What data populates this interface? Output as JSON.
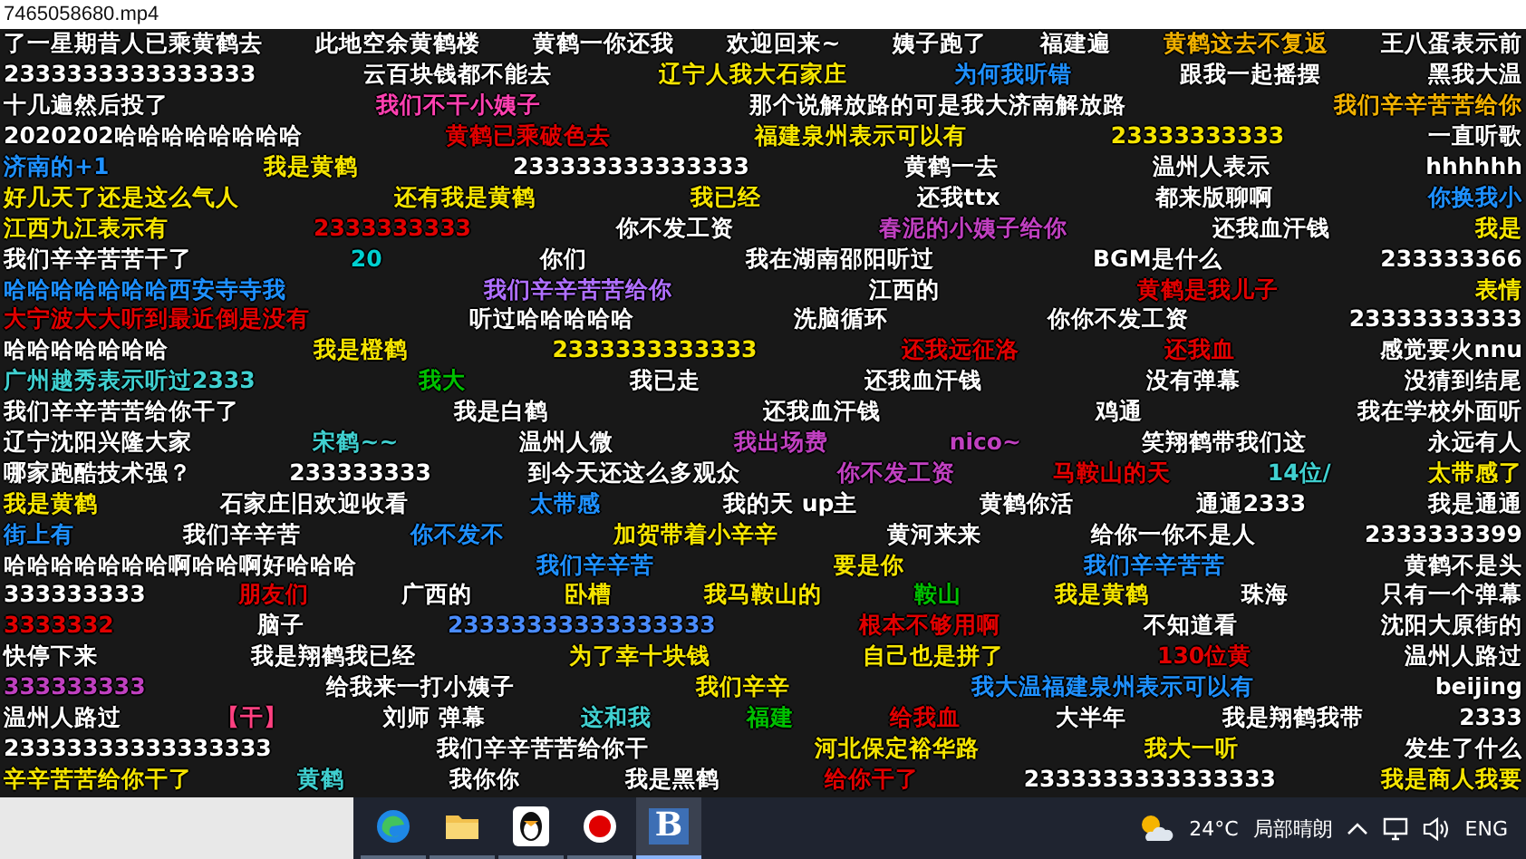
{
  "window": {
    "title": "7465058680.mp4"
  },
  "danmaku_rows": [
    [
      {
        "text": "了一星期昔人已乘黄鹤去",
        "color": "#ffffff"
      },
      {
        "text": "此地空余黄鹤楼",
        "color": "#ffffff"
      },
      {
        "text": "黄鹤一你还我",
        "color": "#ffffff"
      },
      {
        "text": "欢迎回来~",
        "color": "#ffffff"
      },
      {
        "text": "姨子跑了",
        "color": "#ffffff"
      },
      {
        "text": "福建遍",
        "color": "#ffffff"
      },
      {
        "text": "黄鹤这去不复返",
        "color": "#f0b000"
      },
      {
        "text": "王八蛋表示前",
        "color": "#ffffff"
      }
    ],
    [
      {
        "text": "2333333333333333",
        "color": "#ffffff"
      },
      {
        "text": "云百块钱都不能去",
        "color": "#ffffff"
      },
      {
        "text": "辽宁人我大石家庄",
        "color": "#f5e400"
      },
      {
        "text": "为何我听错",
        "color": "#1e90ff"
      },
      {
        "text": "跟我一起摇摆",
        "color": "#ffffff"
      },
      {
        "text": "黑我大温",
        "color": "#ffffff"
      }
    ],
    [
      {
        "text": "十几遍然后投了",
        "color": "#ffffff"
      },
      {
        "text": "我们不干小姨子",
        "color": "#ff40b0"
      },
      {
        "text": "那个说解放路的可是我大济南解放路",
        "color": "#ffffff"
      },
      {
        "text": "我们辛辛苦苦给你",
        "color": "#f0b000"
      }
    ],
    [
      {
        "text": "2020202哈哈哈哈哈哈哈哈",
        "color": "#ffffff"
      },
      {
        "text": "黄鹤已乘破色去",
        "color": "#e00000"
      },
      {
        "text": "福建泉州表示可以有",
        "color": "#f5e400"
      },
      {
        "text": "23333333333",
        "color": "#f5e400"
      },
      {
        "text": "一直听歌",
        "color": "#ffffff"
      }
    ],
    [
      {
        "text": "济南的+1",
        "color": "#1e90ff"
      },
      {
        "text": "我是黄鹤",
        "color": "#f5e400"
      },
      {
        "text": "233333333333333",
        "color": "#ffffff"
      },
      {
        "text": "黄鹤一去",
        "color": "#ffffff"
      },
      {
        "text": "温州人表示",
        "color": "#ffffff"
      },
      {
        "text": "hhhhhh",
        "color": "#ffffff"
      }
    ],
    [
      {
        "text": "好几天了还是这么气人",
        "color": "#f5e400"
      },
      {
        "text": "还有我是黄鹤",
        "color": "#f5e400"
      },
      {
        "text": "我已经",
        "color": "#f5e400"
      },
      {
        "text": "还我ttx",
        "color": "#ffffff"
      },
      {
        "text": "都来版聊啊",
        "color": "#ffffff"
      },
      {
        "text": "你换我小",
        "color": "#1e90ff"
      }
    ],
    [
      {
        "text": "江西九江表示有",
        "color": "#f5e400"
      },
      {
        "text": "2333333333",
        "color": "#e00000"
      },
      {
        "text": "你不发工资",
        "color": "#ffffff"
      },
      {
        "text": "春泥的小姨子给你",
        "color": "#c040c0"
      },
      {
        "text": "还我血汗钱",
        "color": "#ffffff"
      },
      {
        "text": "我是",
        "color": "#f5e400"
      }
    ],
    [
      {
        "text": "我们辛辛苦苦干了",
        "color": "#ffffff"
      },
      {
        "text": "20",
        "color": "#00d0d0"
      },
      {
        "text": "你们",
        "color": "#ffffff"
      },
      {
        "text": "我在湖南邵阳听过",
        "color": "#ffffff"
      },
      {
        "text": "BGM是什么",
        "color": "#ffffff"
      },
      {
        "text": "233333366",
        "color": "#ffffff"
      }
    ],
    [
      {
        "text": "哈哈哈哈哈哈哈西安寺寺我",
        "color": "#1e90ff"
      },
      {
        "text": "我们辛辛苦苦给你",
        "color": "#b070ff"
      },
      {
        "text": "江西的",
        "color": "#ffffff"
      },
      {
        "text": "黄鹤是我儿子",
        "color": "#e00000"
      },
      {
        "text": "表情",
        "color": "#f5e400"
      }
    ],
    [
      {
        "text": "大宁波大大听到最近倒是没有",
        "color": "#e00000"
      },
      {
        "text": "听过哈哈哈哈哈",
        "color": "#ffffff"
      },
      {
        "text": "洗脑循环",
        "color": "#ffffff"
      },
      {
        "text": "你你不发工资",
        "color": "#ffffff"
      },
      {
        "text": "23333333333",
        "color": "#ffffff"
      }
    ],
    [
      {
        "text": "哈哈哈哈哈哈哈",
        "color": "#ffffff"
      },
      {
        "text": "我是橙鹤",
        "color": "#f5e400"
      },
      {
        "text": "2333333333333",
        "color": "#f5e400"
      },
      {
        "text": "还我远征洛",
        "color": "#e00000"
      },
      {
        "text": "还我血",
        "color": "#e00000"
      },
      {
        "text": "感觉要火nnu",
        "color": "#ffffff"
      }
    ],
    [
      {
        "text": "广州越秀表示听过2333",
        "color": "#40d0d0"
      },
      {
        "text": "我大",
        "color": "#00c000"
      },
      {
        "text": "我已走",
        "color": "#ffffff"
      },
      {
        "text": "还我血汗钱",
        "color": "#ffffff"
      },
      {
        "text": "没有弹幕",
        "color": "#ffffff"
      },
      {
        "text": "没猜到结尾",
        "color": "#ffffff"
      }
    ],
    [
      {
        "text": "我们辛辛苦苦给你干了",
        "color": "#ffffff"
      },
      {
        "text": "我是白鹤",
        "color": "#ffffff"
      },
      {
        "text": "还我血汗钱",
        "color": "#ffffff"
      },
      {
        "text": "鸡通",
        "color": "#ffffff"
      },
      {
        "text": "我在学校外面听",
        "color": "#ffffff"
      }
    ],
    [
      {
        "text": "辽宁沈阳兴隆大家",
        "color": "#ffffff"
      },
      {
        "text": "宋鹤~~",
        "color": "#40d0d0"
      },
      {
        "text": "温州人微",
        "color": "#ffffff"
      },
      {
        "text": "我出场费",
        "color": "#c040c0"
      },
      {
        "text": "nico~",
        "color": "#c040c0"
      },
      {
        "text": "笑翔鹤带我们这",
        "color": "#ffffff"
      },
      {
        "text": "永远有人",
        "color": "#ffffff"
      }
    ],
    [
      {
        "text": "哪家跑酷技术强？",
        "color": "#ffffff"
      },
      {
        "text": "233333333",
        "color": "#ffffff"
      },
      {
        "text": "到今天还这么多观众",
        "color": "#ffffff"
      },
      {
        "text": "你不发工资",
        "color": "#c040c0"
      },
      {
        "text": "马鞍山的天",
        "color": "#e00000"
      },
      {
        "text": "14位/",
        "color": "#40d0d0"
      },
      {
        "text": "太带感了",
        "color": "#f5e400"
      }
    ],
    [
      {
        "text": "我是黄鹤",
        "color": "#f5e400"
      },
      {
        "text": "石家庄旧欢迎收看",
        "color": "#ffffff"
      },
      {
        "text": "太带感",
        "color": "#1e90ff"
      },
      {
        "text": "我的天 up主",
        "color": "#ffffff"
      },
      {
        "text": "黄鹤你活",
        "color": "#ffffff"
      },
      {
        "text": "通通2333",
        "color": "#ffffff"
      },
      {
        "text": "我是通通",
        "color": "#ffffff"
      }
    ],
    [
      {
        "text": "街上有",
        "color": "#1e90ff"
      },
      {
        "text": "我们辛辛苦",
        "color": "#ffffff"
      },
      {
        "text": "你不发不",
        "color": "#1e90ff"
      },
      {
        "text": "加贺带着小辛辛",
        "color": "#f5e400"
      },
      {
        "text": "黄河来来",
        "color": "#ffffff"
      },
      {
        "text": "给你一你不是人",
        "color": "#ffffff"
      },
      {
        "text": "2333333399",
        "color": "#ffffff"
      }
    ],
    [
      {
        "text": "哈哈哈哈哈哈哈啊哈哈啊好哈哈哈",
        "color": "#ffffff"
      },
      {
        "text": "我们辛辛苦",
        "color": "#1e90ff"
      },
      {
        "text": "要是你",
        "color": "#f5e400"
      },
      {
        "text": "我们辛辛苦苦",
        "color": "#1e90ff"
      },
      {
        "text": "黄鹤不是头",
        "color": "#ffffff"
      }
    ],
    [
      {
        "text": "333333333",
        "color": "#ffffff"
      },
      {
        "text": "朋友们",
        "color": "#e00000"
      },
      {
        "text": "广西的",
        "color": "#ffffff"
      },
      {
        "text": "卧槽",
        "color": "#f5e400"
      },
      {
        "text": "我马鞍山的",
        "color": "#f5e400"
      },
      {
        "text": "鞍山",
        "color": "#00c000"
      },
      {
        "text": "我是黄鹤",
        "color": "#f5e400"
      },
      {
        "text": "珠海",
        "color": "#ffffff"
      },
      {
        "text": "只有一个弹幕",
        "color": "#ffffff"
      }
    ],
    [
      {
        "text": "3333332",
        "color": "#e00000"
      },
      {
        "text": "脑子",
        "color": "#ffffff"
      },
      {
        "text": "23333333333333333",
        "color": "#4a8cff"
      },
      {
        "text": "根本不够用啊",
        "color": "#e00000"
      },
      {
        "text": "不知道看",
        "color": "#ffffff"
      },
      {
        "text": "沈阳大原街的",
        "color": "#ffffff"
      }
    ],
    [
      {
        "text": "快停下来",
        "color": "#ffffff"
      },
      {
        "text": "我是翔鹤我已经",
        "color": "#ffffff"
      },
      {
        "text": "为了幸十块钱",
        "color": "#f5e400"
      },
      {
        "text": "自己也是拼了",
        "color": "#f5e400"
      },
      {
        "text": "130位黄",
        "color": "#e00000"
      },
      {
        "text": "温州人路过",
        "color": "#ffffff"
      }
    ],
    [
      {
        "text": "333333333",
        "color": "#c040c0"
      },
      {
        "text": "给我来一打小姨子",
        "color": "#ffffff"
      },
      {
        "text": "我们辛辛",
        "color": "#f5e400"
      },
      {
        "text": "我大温福建泉州表示可以有",
        "color": "#1e90ff"
      },
      {
        "text": "beijing",
        "color": "#ffffff"
      }
    ],
    [
      {
        "text": "温州人路过",
        "color": "#ffffff"
      },
      {
        "text": "【干】",
        "color": "#ff4080"
      },
      {
        "text": "刘师 弹幕",
        "color": "#ffffff"
      },
      {
        "text": "这和我",
        "color": "#40d0d0"
      },
      {
        "text": "福建",
        "color": "#00c000"
      },
      {
        "text": "给我血",
        "color": "#e00000"
      },
      {
        "text": "大半年",
        "color": "#ffffff"
      },
      {
        "text": "我是翔鹤我带",
        "color": "#ffffff"
      },
      {
        "text": "2333",
        "color": "#ffffff"
      }
    ],
    [
      {
        "text": "23333333333333333",
        "color": "#ffffff"
      },
      {
        "text": "我们辛辛苦苦给你干",
        "color": "#ffffff"
      },
      {
        "text": "河北保定裕华路",
        "color": "#f5e400"
      },
      {
        "text": "我大一听",
        "color": "#f5e400"
      },
      {
        "text": "发生了什么",
        "color": "#ffffff"
      }
    ],
    [
      {
        "text": "辛辛苦苦给你干了",
        "color": "#f5e400"
      },
      {
        "text": "黄鹤",
        "color": "#40d0d0"
      },
      {
        "text": "我你你",
        "color": "#ffffff"
      },
      {
        "text": "我是黑鹤",
        "color": "#ffffff"
      },
      {
        "text": "给你干了",
        "color": "#e00000"
      },
      {
        "text": "2333333333333333",
        "color": "#ffffff"
      },
      {
        "text": "我是商人我要",
        "color": "#f5e400"
      }
    ]
  ],
  "taskbar": {
    "apps": [
      {
        "kind": "edge",
        "selected": false
      },
      {
        "kind": "folder",
        "selected": false
      },
      {
        "kind": "penguin",
        "selected": false
      },
      {
        "kind": "record",
        "selected": false
      },
      {
        "kind": "letter",
        "label": "B",
        "selected": true
      }
    ],
    "weather": {
      "temperature": "24°C",
      "condition": "局部晴朗"
    },
    "language": "ENG"
  }
}
